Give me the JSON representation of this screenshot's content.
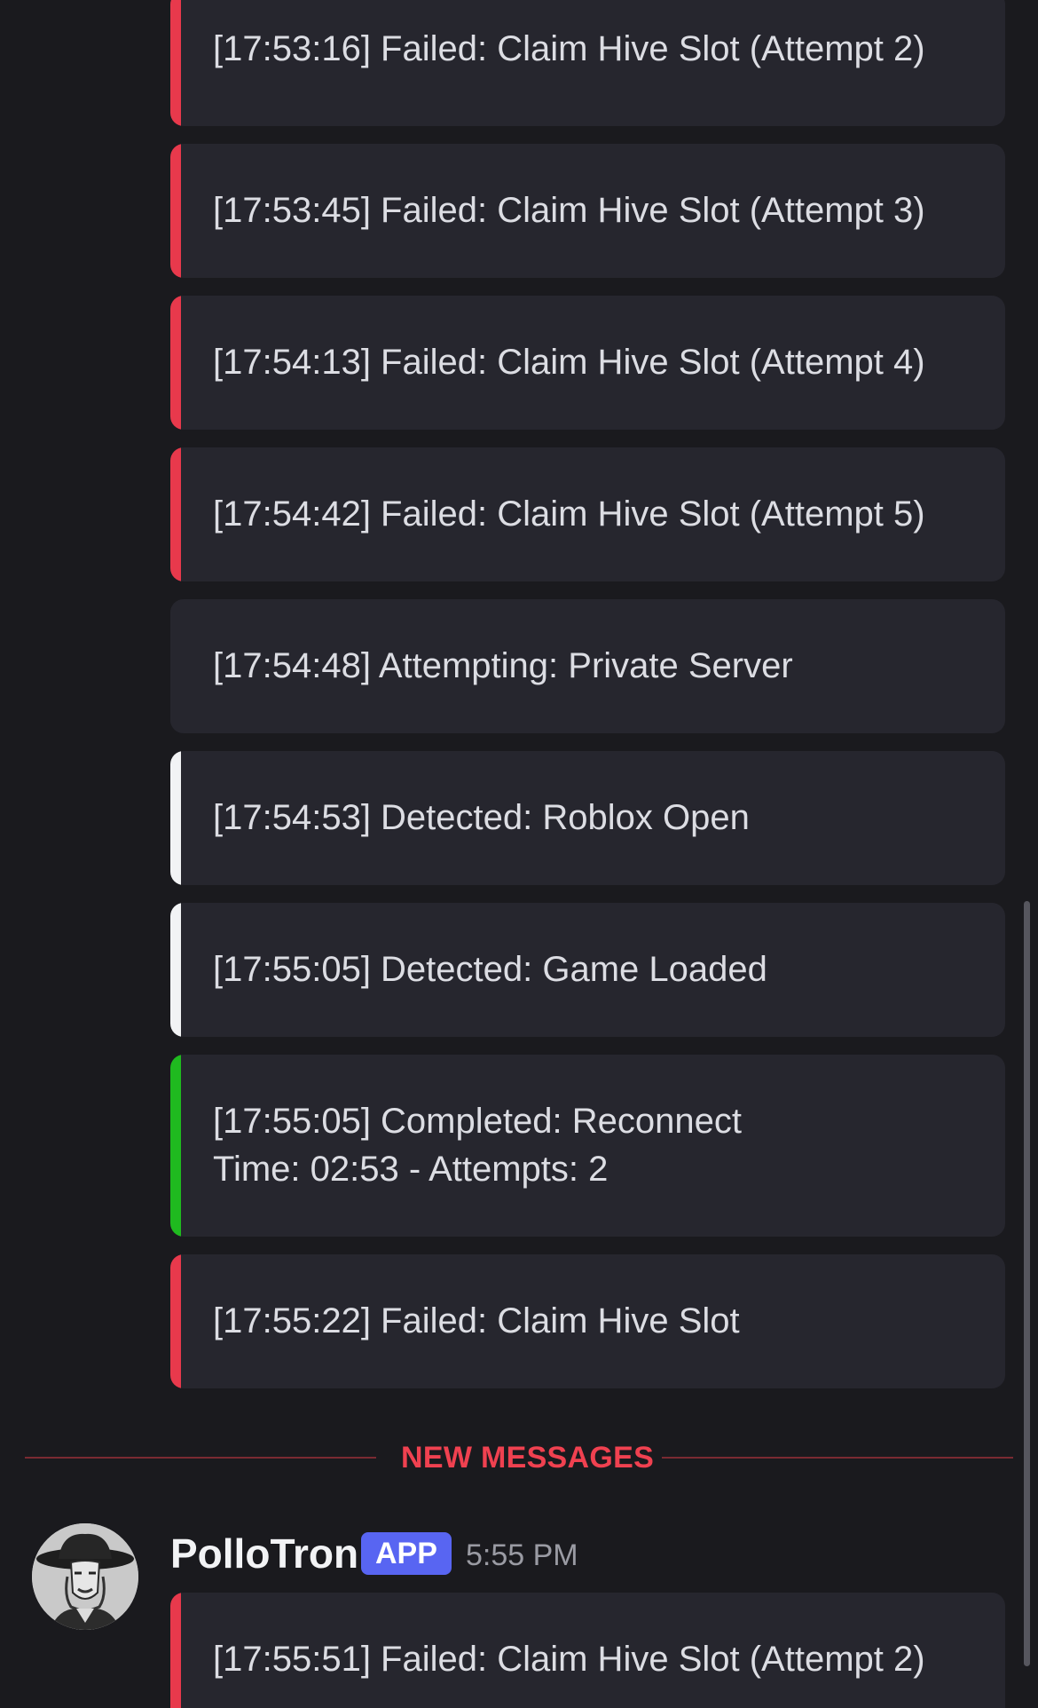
{
  "colors": {
    "background": "#1a1a1e",
    "embed_background": "#26262e",
    "failed": "#e8394c",
    "detected": "#f2f3f5",
    "completed": "#1fba1f",
    "attempting": "#26262e",
    "new_messages": "#f04150",
    "app_badge": "#5865f2"
  },
  "log_entries": [
    {
      "lines": [
        "[17:53:16] Failed: Claim Hive Slot (Attempt 2)"
      ],
      "status": "failed"
    },
    {
      "lines": [
        "[17:53:45] Failed: Claim Hive Slot (Attempt 3)"
      ],
      "status": "failed"
    },
    {
      "lines": [
        "[17:54:13] Failed: Claim Hive Slot (Attempt 4)"
      ],
      "status": "failed"
    },
    {
      "lines": [
        "[17:54:42] Failed: Claim Hive Slot (Attempt 5)"
      ],
      "status": "failed"
    },
    {
      "lines": [
        "[17:54:48] Attempting: Private Server"
      ],
      "status": "attempting"
    },
    {
      "lines": [
        "[17:54:53] Detected: Roblox Open"
      ],
      "status": "detected"
    },
    {
      "lines": [
        "[17:55:05] Detected: Game Loaded"
      ],
      "status": "detected"
    },
    {
      "lines": [
        "[17:55:05] Completed: Reconnect",
        "Time: 02:53 - Attempts: 2"
      ],
      "status": "completed"
    },
    {
      "lines": [
        "[17:55:22] Failed: Claim Hive Slot"
      ],
      "status": "failed"
    }
  ],
  "divider": {
    "label": "NEW MESSAGES"
  },
  "new_message": {
    "author": "PolloTron",
    "badge": "APP",
    "timestamp": "5:55 PM",
    "avatar_icon": "cowboy-avatar",
    "entry": {
      "lines": [
        "[17:55:51] Failed: Claim Hive Slot (Attempt 2)"
      ],
      "status": "failed"
    }
  }
}
